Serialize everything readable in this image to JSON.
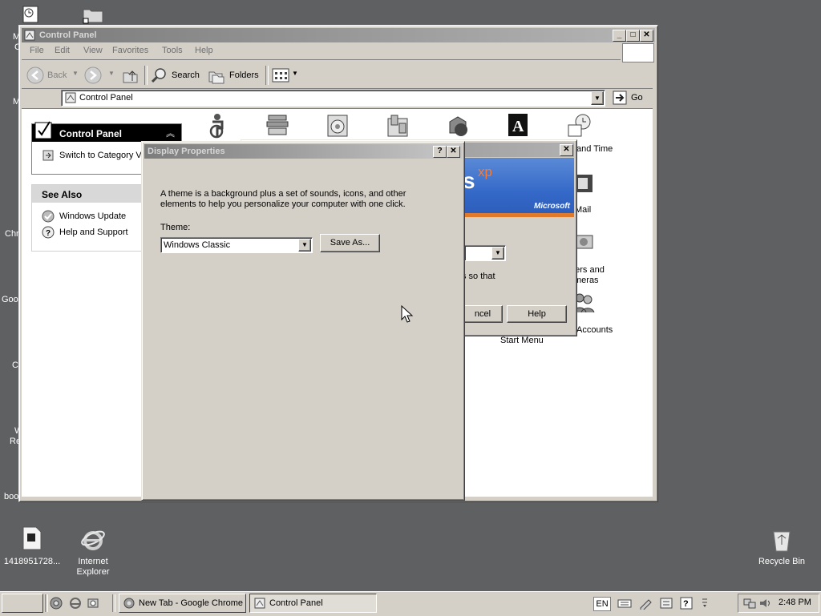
{
  "desktop": {
    "icons": [
      {
        "label": "1418951728...",
        "icon": "image-file-icon"
      },
      {
        "label": "Internet Explorer",
        "icon": "ie-icon"
      },
      {
        "label": "Recycle Bin",
        "icon": "recycle-bin-icon"
      }
    ],
    "left_edge_labels": [
      "M",
      "C",
      "M",
      "Chr",
      "Goo",
      "C",
      "W",
      "Re",
      "boo"
    ]
  },
  "control_panel": {
    "title": "Control Panel",
    "menu": [
      "File",
      "Edit",
      "View",
      "Favorites",
      "Tools",
      "Help"
    ],
    "toolbar": {
      "back": "Back",
      "search": "Search",
      "folders": "Folders"
    },
    "address_value": "Control Panel",
    "go_label": "Go",
    "side_panel": {
      "header": "Control Panel",
      "switch_label": "Switch to Category V",
      "see_also_header": "See Also",
      "links": [
        "Windows Update",
        "Help and Support"
      ]
    },
    "icon_labels": {
      "date_time": "and Time",
      "mail": "Mail",
      "scanners_1": "ners and",
      "scanners_2": "meras",
      "accounts": "Accounts",
      "start_menu": "Start Menu"
    }
  },
  "bg_dialog": {
    "xp_text": "s",
    "xp_sup": "xp",
    "microsoft": "Microsoft",
    "so_that": "s so that",
    "cancel": "ncel",
    "help": "Help"
  },
  "display_properties": {
    "title": "Display Properties",
    "description": "A theme is a background plus a set of sounds, icons, and other elements to help you personalize your computer with one click.",
    "theme_label": "Theme:",
    "theme_value": "Windows Classic",
    "save_as": "Save As..."
  },
  "taskbar": {
    "tasks": [
      "New Tab - Google Chrome",
      "Control Panel"
    ],
    "language": "EN",
    "clock": "2:48 PM"
  }
}
